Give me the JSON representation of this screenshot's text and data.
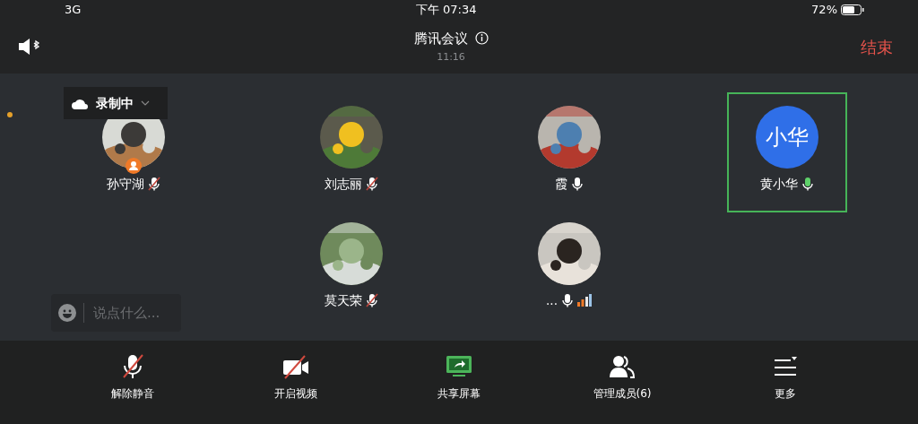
{
  "status_bar": {
    "network": "3G",
    "time": "下午 07:34",
    "battery": "72%"
  },
  "header": {
    "title": "腾讯会议",
    "duration": "11:16",
    "end_button": "结束"
  },
  "recording": {
    "label": "录制中"
  },
  "participant_rows": [
    {
      "participants": [
        {
          "name": "孙守湖",
          "muted": true,
          "speaking": false,
          "host": true,
          "selected": false,
          "weak_signal": false
        },
        {
          "name": "刘志丽",
          "muted": true,
          "speaking": false,
          "host": false,
          "selected": false,
          "weak_signal": false
        },
        {
          "name": "霞",
          "muted": false,
          "speaking": false,
          "host": false,
          "selected": false,
          "weak_signal": false
        },
        {
          "name": "黄小华",
          "muted": false,
          "speaking": true,
          "avatar": {
            "kind": "initials",
            "text": "小华"
          },
          "host": false,
          "selected": true,
          "weak_signal": false
        }
      ]
    },
    {
      "participants": [
        {
          "name": "莫天荣",
          "muted": true,
          "speaking": false,
          "host": false,
          "selected": false,
          "weak_signal": false
        },
        {
          "name": "...",
          "muted": false,
          "speaking": false,
          "host": false,
          "selected": false,
          "weak_signal": true
        }
      ]
    }
  ],
  "chat": {
    "placeholder": "说点什么..."
  },
  "toolbar": [
    {
      "kind": "mic_muted",
      "label": "解除静音"
    },
    {
      "kind": "video_off",
      "label": "开启视频"
    },
    {
      "kind": "share",
      "label": "共享屏幕"
    },
    {
      "kind": "members",
      "label": "管理成员(6)"
    },
    {
      "kind": "more",
      "label": "更多"
    }
  ]
}
